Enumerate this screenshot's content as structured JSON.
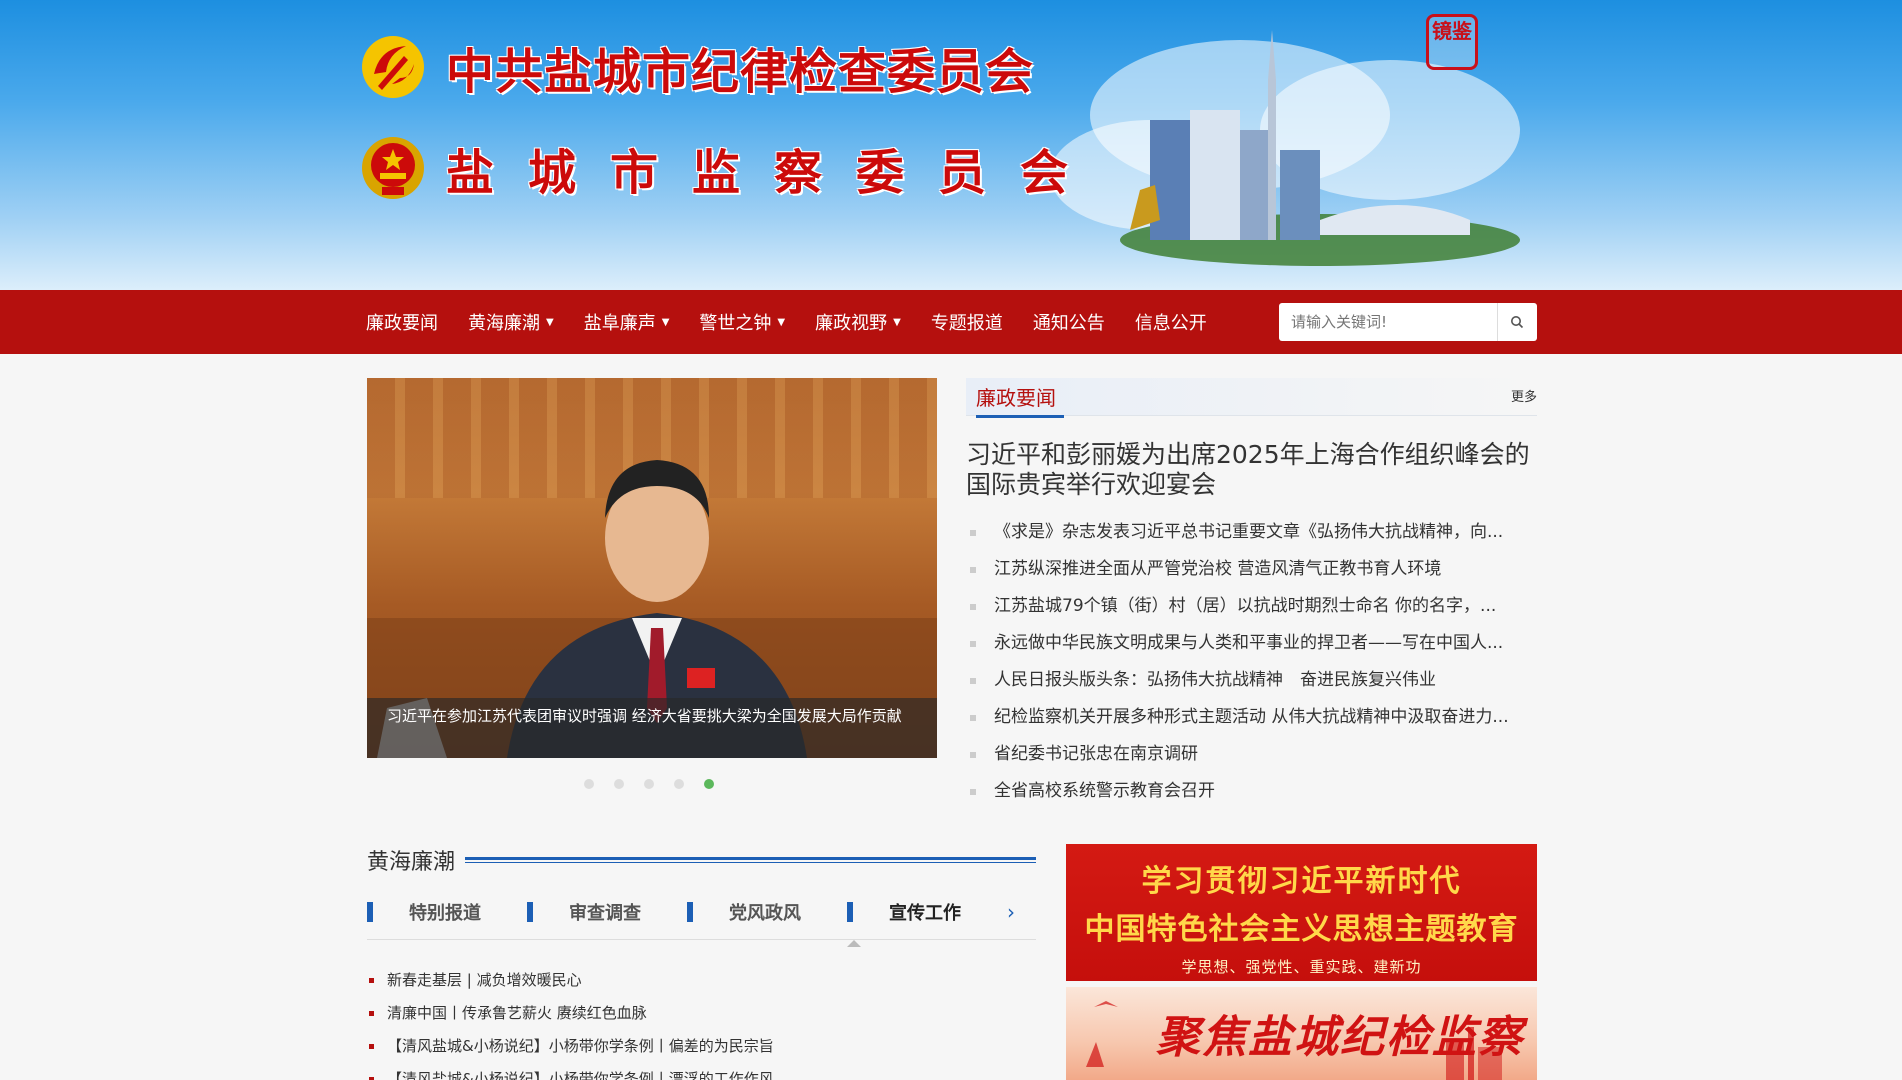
{
  "header": {
    "title_line1": "中共盐城市纪律检查委员会",
    "title_line2": "盐城市监察委员会",
    "seal_text": "镜鉴"
  },
  "nav": {
    "items": [
      {
        "label": "廉政要闻",
        "dropdown": false
      },
      {
        "label": "黄海廉潮",
        "dropdown": true
      },
      {
        "label": "盐阜廉声",
        "dropdown": true
      },
      {
        "label": "警世之钟",
        "dropdown": true
      },
      {
        "label": "廉政视野",
        "dropdown": true
      },
      {
        "label": "专题报道",
        "dropdown": false
      },
      {
        "label": "通知公告",
        "dropdown": false
      },
      {
        "label": "信息公开",
        "dropdown": false
      }
    ],
    "search_placeholder": "请输入关键词!"
  },
  "carousel": {
    "caption": "习近平在参加江苏代表团审议时强调 经济大省要挑大梁为全国发展大局作贡献",
    "slide_count": 5,
    "active_index": 4
  },
  "news": {
    "section_title": "廉政要闻",
    "more_label": "更多",
    "headline": "习近平和彭丽媛为出席2025年上海合作组织峰会的国际贵宾举行欢迎宴会",
    "items": [
      "《求是》杂志发表习近平总书记重要文章《弘扬伟大抗战精神，向...",
      "江苏纵深推进全面从严管党治校 营造风清气正教书育人环境",
      "江苏盐城79个镇（街）村（居）以抗战时期烈士命名 你的名字，...",
      "永远做中华民族文明成果与人类和平事业的捍卫者——写在中国人...",
      "人民日报头版头条：弘扬伟大抗战精神　奋进民族复兴伟业",
      "纪检监察机关开展多种形式主题活动 从伟大抗战精神中汲取奋进力...",
      "省纪委书记张忠在南京调研",
      "全省高校系统警示教育会召开"
    ]
  },
  "section2": {
    "title": "黄海廉潮",
    "tabs": [
      "特别报道",
      "审查调查",
      "党风政风",
      "宣传工作"
    ],
    "active_tab": 3,
    "items": [
      "新春走基层 | 减负增效暖民心",
      "清廉中国丨传承鲁艺薪火 赓续红色血脉",
      "【清风盐城&小杨说纪】小杨带你学条例丨偏差的为民宗旨",
      "【清风盐城&小杨说纪】小杨带你学条例丨漂浮的工作作风"
    ]
  },
  "banners": {
    "banner1_line1": "学习贯彻习近平新时代",
    "banner1_line2": "中国特色社会主义思想主题教育",
    "banner1_line3": "学思想、强党性、重实践、建新功",
    "banner2_text": "聚焦盐城纪检监察"
  },
  "colors": {
    "nav_bg": "#b5100e",
    "title_red": "#cc0a0a",
    "accent_blue": "#1c5fb5",
    "dot_active": "#5cb85c"
  }
}
